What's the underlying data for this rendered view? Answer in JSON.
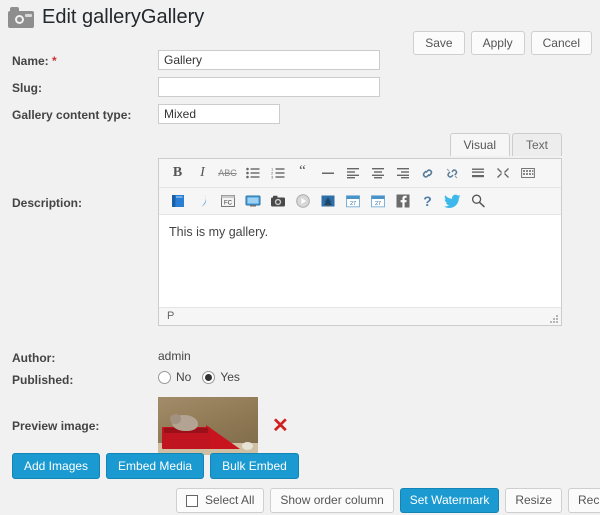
{
  "header": {
    "icon": "camera-icon",
    "title": "Edit galleryGallery"
  },
  "top_actions": {
    "save_label": "Save",
    "apply_label": "Apply",
    "cancel_label": "Cancel"
  },
  "form": {
    "name": {
      "label": "Name:",
      "required_marker": "*",
      "value": "Gallery",
      "placeholder": ""
    },
    "slug": {
      "label": "Slug:",
      "value": "",
      "placeholder": ""
    },
    "content_type": {
      "label": "Gallery content type:",
      "value": "Mixed",
      "options": [
        "Mixed"
      ]
    },
    "description": {
      "label": "Description:",
      "body_text": "This is my gallery.",
      "status_text": "P"
    },
    "author": {
      "label": "Author:",
      "value": "admin"
    },
    "published": {
      "label": "Published:",
      "no_label": "No",
      "yes_label": "Yes",
      "selected": "Yes"
    },
    "preview_image": {
      "label": "Preview image:",
      "alt": "kitten-in-red-box-thumbnail",
      "delete_glyph": "✕"
    }
  },
  "editor": {
    "tabs": [
      {
        "label": "Visual",
        "active": true
      },
      {
        "label": "Text",
        "active": false
      }
    ],
    "toolbar_row1": [
      "bold-icon",
      "italic-icon",
      "strikethrough-icon",
      "unordered-list-icon",
      "ordered-list-icon",
      "blockquote-icon",
      "horizontal-rule-icon",
      "align-left-icon",
      "align-center-icon",
      "align-right-icon",
      "insert-link-icon",
      "unlink-icon",
      "read-more-icon",
      "fullscreen-icon",
      "kitchen-sink-icon"
    ],
    "toolbar_row2": [
      "book-icon",
      "swirl-icon",
      "fc-icon",
      "screen-icon",
      "camera-icon",
      "play-icon",
      "tree-icon",
      "calendar-icon",
      "calendar-27-icon",
      "facebook-icon",
      "help-icon",
      "twitter-icon",
      "search-icon"
    ],
    "calendar_day": "27"
  },
  "media_buttons": [
    {
      "label": "Add Images"
    },
    {
      "label": "Embed Media"
    },
    {
      "label": "Bulk Embed"
    }
  ],
  "bottom_bar": [
    {
      "label": "Select All",
      "checkbox": true,
      "active": false
    },
    {
      "label": "Show order column",
      "checkbox": false,
      "active": false
    },
    {
      "label": "Set Watermark",
      "checkbox": false,
      "active": true
    },
    {
      "label": "Resize",
      "checkbox": false,
      "active": false
    },
    {
      "label": "Recreate Thumbnails",
      "checkbox": false,
      "active": false
    }
  ],
  "colors": {
    "page_background": "#f1f1f1",
    "accent_blue": "#1a9ad0",
    "required_red": "#cc3333",
    "delete_red": "#d02020",
    "title_text": "#23282d"
  }
}
